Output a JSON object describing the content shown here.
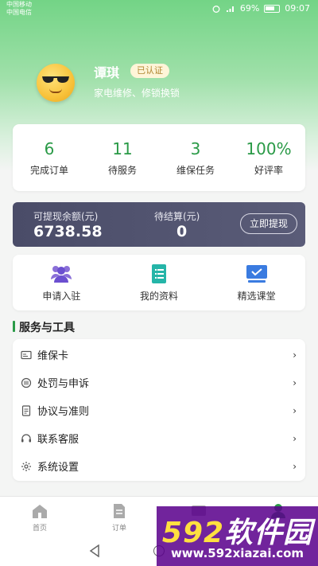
{
  "status_bar": {
    "carrier1": "中国移动",
    "carrier2": "中国电信",
    "battery": "69%",
    "time": "09:07"
  },
  "profile": {
    "name": "谭琪",
    "badge": "已认证",
    "description": "家电维修、修锁换锁"
  },
  "stats": [
    {
      "value": "6",
      "label": "完成订单"
    },
    {
      "value": "11",
      "label": "待服务"
    },
    {
      "value": "3",
      "label": "维保任务"
    },
    {
      "value": "100%",
      "label": "好评率"
    }
  ],
  "balance": {
    "available_label": "可提现余额(元)",
    "available_value": "6738.58",
    "pending_label": "待结算(元)",
    "pending_value": "0",
    "withdraw_label": "立即提现"
  },
  "shortcuts": [
    {
      "label": "申请入驻",
      "icon": "users-icon"
    },
    {
      "label": "我的资料",
      "icon": "document-icon"
    },
    {
      "label": "精选课堂",
      "icon": "classroom-icon"
    }
  ],
  "section": {
    "title": "服务与工具"
  },
  "menu": [
    {
      "label": "维保卡",
      "icon": "card-icon"
    },
    {
      "label": "处罚与申诉",
      "icon": "appeal-icon"
    },
    {
      "label": "协议与准则",
      "icon": "agreement-icon"
    },
    {
      "label": "联系客服",
      "icon": "headset-icon"
    },
    {
      "label": "系统设置",
      "icon": "gear-icon"
    }
  ],
  "chevron": "›",
  "tabs": [
    {
      "label": "首页",
      "icon": "home-icon"
    },
    {
      "label": "订单",
      "icon": "order-icon"
    }
  ],
  "watermark": {
    "brand_num": "592",
    "brand_text": "软件园",
    "url": "www.592xiazai.com"
  },
  "colors": {
    "accent": "#2a9a47",
    "hero": "#73d486",
    "balance_card": "#4a4c68"
  }
}
